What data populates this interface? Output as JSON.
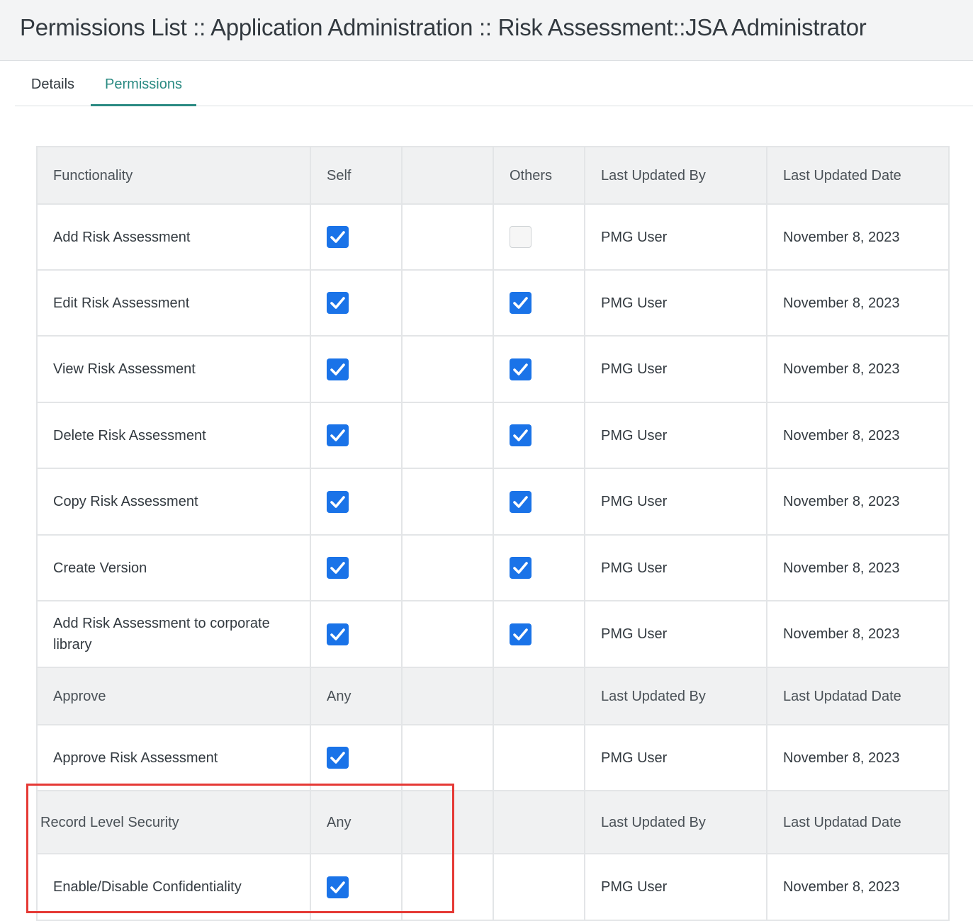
{
  "page": {
    "title": "Permissions List :: Application Administration :: Risk Assessment::JSA Administrator"
  },
  "tabs": [
    {
      "label": "Details",
      "active": false
    },
    {
      "label": "Permissions",
      "active": true
    }
  ],
  "table": {
    "header": {
      "functionality": "Functionality",
      "self": "Self",
      "blank": "",
      "others": "Others",
      "last_updated_by": "Last Updated By",
      "last_updated_date": "Last Updated Date"
    },
    "rows": [
      {
        "name": "Add Risk Assessment",
        "self": true,
        "others": false,
        "by": "PMG User",
        "date": "November 8, 2023"
      },
      {
        "name": "Edit Risk Assessment",
        "self": true,
        "others": true,
        "by": "PMG User",
        "date": "November 8, 2023"
      },
      {
        "name": "View Risk Assessment",
        "self": true,
        "others": true,
        "by": "PMG User",
        "date": "November 8, 2023"
      },
      {
        "name": "Delete Risk Assessment",
        "self": true,
        "others": true,
        "by": "PMG User",
        "date": "November 8, 2023"
      },
      {
        "name": "Copy Risk Assessment",
        "self": true,
        "others": true,
        "by": "PMG User",
        "date": "November 8, 2023"
      },
      {
        "name": "Create Version",
        "self": true,
        "others": true,
        "by": "PMG User",
        "date": "November 8, 2023"
      },
      {
        "name": "Add Risk Assessment to corporate library",
        "self": true,
        "others": true,
        "by": "PMG User",
        "date": "November 8, 2023"
      }
    ],
    "approve_header": {
      "label": "Approve",
      "any": "Any",
      "last_updated_by": "Last Updated By",
      "last_updated_date": "Last Updatad Date"
    },
    "approve_rows": [
      {
        "name": "Approve Risk Assessment",
        "any": true,
        "by": "PMG User",
        "date": "November 8, 2023"
      }
    ],
    "rls_header": {
      "label": "Record Level Security",
      "any": "Any",
      "last_updated_by": "Last Updated By",
      "last_updated_date": "Last Updatad Date"
    },
    "rls_rows": [
      {
        "name": "Enable/Disable Confidentiality",
        "any": true,
        "by": "PMG User",
        "date": "November 8, 2023"
      }
    ]
  },
  "colors": {
    "accent": "#2a8a82",
    "checkbox": "#1a73e8",
    "highlight": "#e53935"
  }
}
